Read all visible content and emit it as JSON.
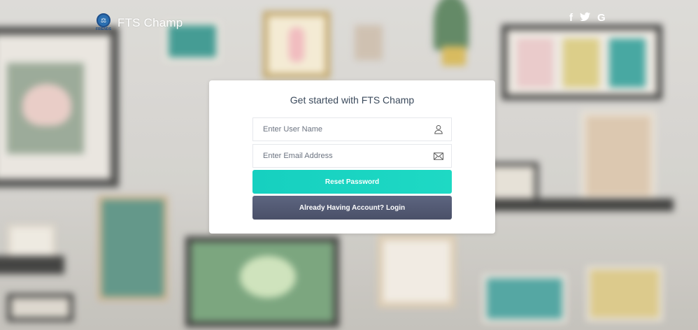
{
  "header": {
    "brand_name": "FTS Champ",
    "logo_tag": "FRIENDS",
    "social": [
      {
        "icon": "facebook-icon",
        "glyph": "f"
      },
      {
        "icon": "twitter-icon",
        "glyph": "🐦"
      },
      {
        "icon": "google-icon",
        "glyph": "G"
      }
    ]
  },
  "form": {
    "title": "Get started with FTS Champ",
    "username_placeholder": "Enter User Name",
    "username_value": "",
    "email_placeholder": "Enter Email Address",
    "email_value": "",
    "reset_label": "Reset Password",
    "login_label": "Already Having Account? Login"
  },
  "colors": {
    "primary_button": "#1ed4c2",
    "secondary_button": "#535a73",
    "title_text": "#3b4a5c"
  }
}
